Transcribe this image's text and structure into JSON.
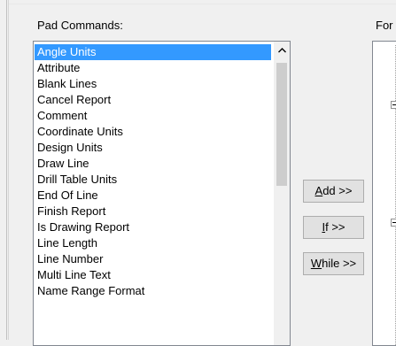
{
  "pad_commands_label": "Pad Commands:",
  "format_label": "For",
  "pad_commands": [
    "Angle Units",
    "Attribute",
    "Blank Lines",
    "Cancel Report",
    "Comment",
    "Coordinate Units",
    "Design Units",
    "Draw Line",
    "Drill Table Units",
    "End Of Line",
    "Finish Report",
    "Is Drawing Report",
    "Line Length",
    "Line Number",
    "Multi Line Text",
    "Name Range Format"
  ],
  "selected_index": 0,
  "buttons": {
    "add": {
      "mnemonic": "A",
      "rest": "dd >>"
    },
    "if": {
      "mnemonic": "I",
      "rest": "f >>"
    },
    "while": {
      "mnemonic": "W",
      "rest": "hile >>"
    }
  },
  "colors": {
    "selection": "#3399ff",
    "window": "#f0f0f0"
  },
  "icons": {
    "scroll_up": "chevron-up-icon",
    "tree_toggle": "minus-box-icon"
  }
}
